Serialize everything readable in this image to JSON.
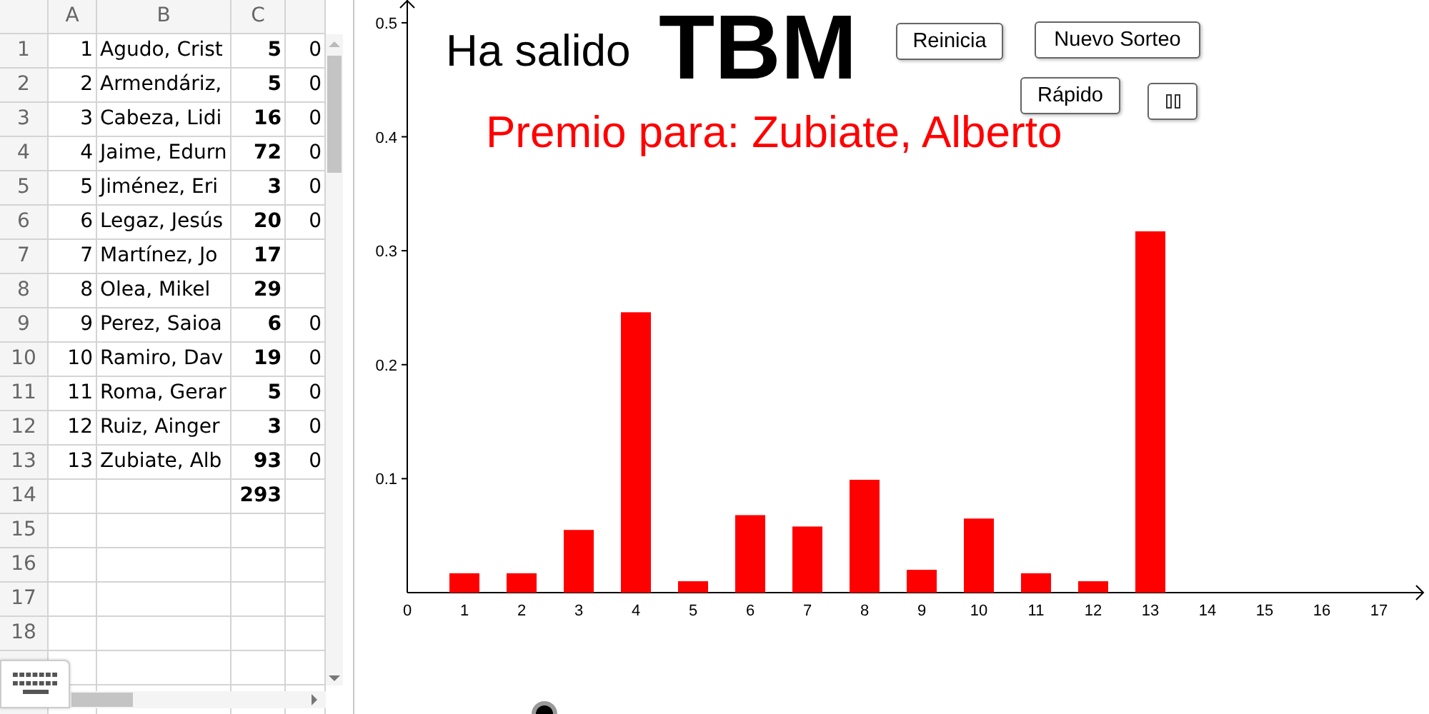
{
  "spreadsheet": {
    "columns": [
      "A",
      "B",
      "C"
    ],
    "rows": [
      {
        "number": "1",
        "a": "1",
        "b": "Agudo, Crist",
        "c": "5",
        "d": "0"
      },
      {
        "number": "2",
        "a": "2",
        "b": "Armendáriz,",
        "c": "5",
        "d": "0"
      },
      {
        "number": "3",
        "a": "3",
        "b": "Cabeza, Lidi",
        "c": "16",
        "d": "0"
      },
      {
        "number": "4",
        "a": "4",
        "b": "Jaime, Edurn",
        "c": "72",
        "d": "0"
      },
      {
        "number": "5",
        "a": "5",
        "b": "Jiménez, Eri",
        "c": "3",
        "d": "0"
      },
      {
        "number": "6",
        "a": "6",
        "b": "Legaz, Jesús",
        "c": "20",
        "d": "0"
      },
      {
        "number": "7",
        "a": "7",
        "b": "Martínez, Jo",
        "c": "17"
      },
      {
        "number": "8",
        "a": "8",
        "b": "Olea, Mikel",
        "c": "29"
      },
      {
        "number": "9",
        "a": "9",
        "b": "Perez, Saioa",
        "c": "6",
        "d": "0"
      },
      {
        "number": "10",
        "a": "10",
        "b": "Ramiro, Dav",
        "c": "19",
        "d": "0"
      },
      {
        "number": "11",
        "a": "11",
        "b": "Roma, Gerar",
        "c": "5",
        "d": "0"
      },
      {
        "number": "12",
        "a": "12",
        "b": "Ruiz, Ainger",
        "c": "3",
        "d": "0"
      },
      {
        "number": "13",
        "a": "13",
        "b": "Zubiate, Alb",
        "c": "93",
        "d": "0"
      },
      {
        "number": "14",
        "c": "293"
      },
      {
        "number": "15"
      },
      {
        "number": "16"
      },
      {
        "number": "17"
      },
      {
        "number": "18"
      }
    ]
  },
  "header": {
    "prefix": "Ha salido",
    "code": "TBM",
    "prize": "Premio para: Zubiate, Alberto"
  },
  "buttons": [
    {
      "kind": "text",
      "label": "Reinicia"
    },
    {
      "kind": "text",
      "label": "Nuevo Sorteo"
    },
    {
      "kind": "text",
      "label": "Rápido"
    },
    {
      "kind": "pause"
    }
  ],
  "chart_data": {
    "type": "bar",
    "x": [
      1,
      2,
      3,
      4,
      5,
      6,
      7,
      8,
      9,
      10,
      11,
      12,
      13
    ],
    "series": [
      {
        "color": "#ff0000",
        "values": [
          0.017,
          0.017,
          0.055,
          0.246,
          0.01,
          0.068,
          0.058,
          0.099,
          0.02,
          0.065,
          0.017,
          0.01,
          0.317
        ]
      }
    ],
    "xlim": [
      0,
      17.8
    ],
    "ylim": [
      0,
      0.52
    ],
    "xticks": [
      0,
      1,
      2,
      3,
      4,
      5,
      6,
      7,
      8,
      9,
      10,
      11,
      12,
      13,
      14,
      15,
      16,
      17
    ],
    "yticks": [
      0.1,
      0.2,
      0.3,
      0.4,
      0.5
    ]
  }
}
